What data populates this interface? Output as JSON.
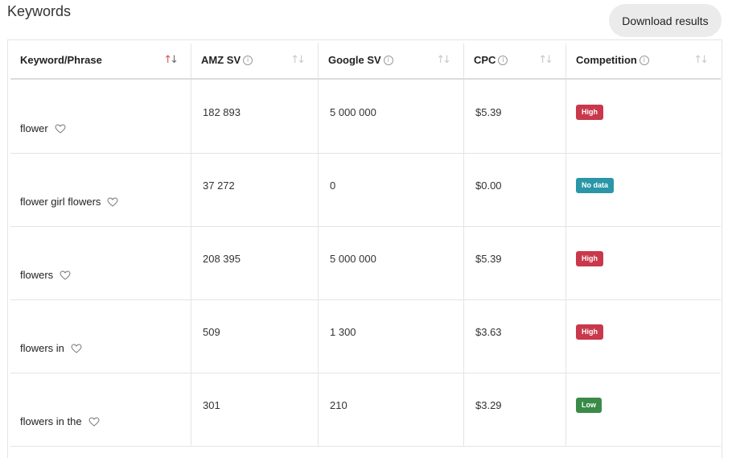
{
  "header": {
    "title": "Keywords",
    "download_label": "Download results"
  },
  "table": {
    "columns": [
      {
        "label": "Keyword/Phrase",
        "info": false
      },
      {
        "label": "AMZ SV",
        "info": true
      },
      {
        "label": "Google SV",
        "info": true
      },
      {
        "label": "CPC",
        "info": true
      },
      {
        "label": "Competition",
        "info": true
      }
    ],
    "rows": [
      {
        "keyword": "flower",
        "amz_sv": "182 893",
        "google_sv": "5 000 000",
        "cpc": "$5.39",
        "competition": "High"
      },
      {
        "keyword": "flower girl flowers",
        "amz_sv": "37 272",
        "google_sv": "0",
        "cpc": "$0.00",
        "competition": "No data"
      },
      {
        "keyword": "flowers",
        "amz_sv": "208 395",
        "google_sv": "5 000 000",
        "cpc": "$5.39",
        "competition": "High"
      },
      {
        "keyword": "flowers in",
        "amz_sv": "509",
        "google_sv": "1 300",
        "cpc": "$3.63",
        "competition": "High"
      },
      {
        "keyword": "flowers in the",
        "amz_sv": "301",
        "google_sv": "210",
        "cpc": "$3.29",
        "competition": "Low"
      }
    ]
  },
  "badge_colors": {
    "High": "#c9384b",
    "No data": "#2a96a8",
    "Low": "#3a8b48"
  },
  "icons": {
    "info": "info-circle-icon",
    "sort": "sort-arrows-icon",
    "favorite": "heart-outline-icon"
  }
}
